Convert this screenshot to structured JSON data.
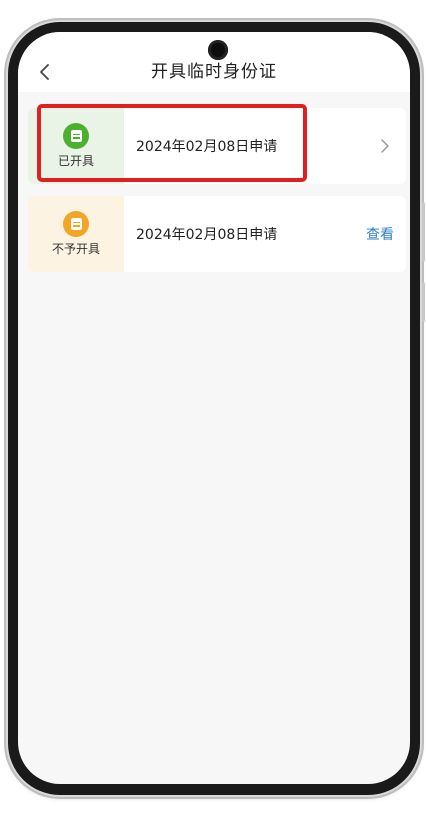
{
  "header": {
    "title": "开具临时身份证",
    "back_icon": "chevron-left-icon"
  },
  "applications": [
    {
      "status": "已开具",
      "status_icon": "document-icon",
      "status_color": "#4caf2f",
      "date_text": "2024年02月08日申请",
      "action_icon": "chevron-right-icon"
    },
    {
      "status": "不予开具",
      "status_icon": "document-icon",
      "status_color": "#f2a623",
      "date_text": "2024年02月08日申请",
      "action_label": "查看",
      "action_color": "#2f7fc7"
    }
  ],
  "annotation": {
    "highlight_color": "#e02020"
  }
}
